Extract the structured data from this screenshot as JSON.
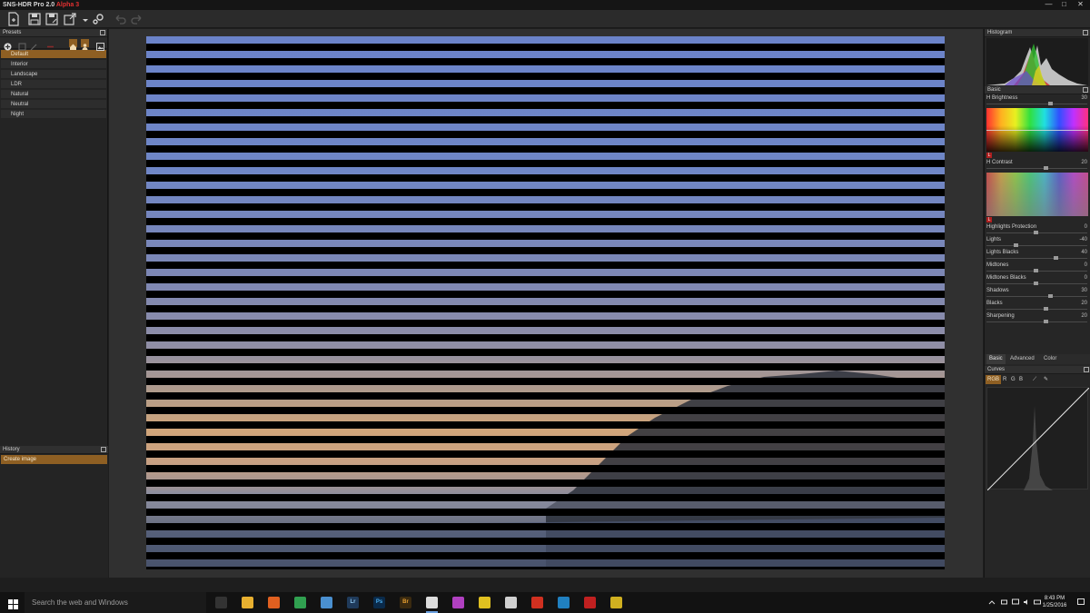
{
  "window": {
    "app_name": "SNS-HDR Pro 2.0",
    "app_version_tag": "Alpha 3",
    "controls": {
      "minimize": "—",
      "maximize": "□",
      "close": "✕"
    }
  },
  "toolbar": {
    "icons": [
      "new-file-icon",
      "save-icon",
      "save-as-icon",
      "export-icon",
      "settings-icon",
      "undo-icon",
      "redo-icon"
    ]
  },
  "presets": {
    "title": "Presets",
    "items": [
      "Default",
      "Interior",
      "Landscape",
      "LDR",
      "Natural",
      "Neutral",
      "Night"
    ],
    "selected": "Default"
  },
  "history": {
    "title": "History",
    "entries": [
      "Create image"
    ]
  },
  "histogram": {
    "title": "Histogram"
  },
  "basic": {
    "title": "Basic",
    "brightness": {
      "label": "Brightness",
      "value": "30",
      "level": 0.65
    },
    "contrast": {
      "label": "Contrast",
      "value": "20",
      "level": 0.6
    },
    "sliders": [
      {
        "label": "Highlights Protection",
        "value": "0",
        "level": 0.5
      },
      {
        "label": "Lights",
        "value": "-40",
        "level": 0.3
      },
      {
        "label": "Lights Blacks",
        "value": "40",
        "level": 0.7
      },
      {
        "label": "Midtones",
        "value": "0",
        "level": 0.5
      },
      {
        "label": "Midtones Blacks",
        "value": "0",
        "level": 0.5
      },
      {
        "label": "Shadows",
        "value": "30",
        "level": 0.65
      },
      {
        "label": "Blacks",
        "value": "20",
        "level": 0.6
      },
      {
        "label": "Sharpening",
        "value": "20",
        "level": 0.6
      }
    ],
    "lock_marker": "L"
  },
  "panel_tabs": [
    "Basic",
    "Advanced",
    "Color"
  ],
  "panel_tab_active": "Basic",
  "curves": {
    "title": "Curves",
    "channels": [
      "RGB",
      "R",
      "G",
      "B"
    ],
    "active_channel": "RGB"
  },
  "taskbar": {
    "search_placeholder": "Search the web and Windows",
    "apps": [
      {
        "name": "task-view-icon",
        "label": ""
      },
      {
        "name": "file-explorer-icon",
        "label": ""
      },
      {
        "name": "firefox-icon",
        "label": ""
      },
      {
        "name": "chrome-icon",
        "label": ""
      },
      {
        "name": "browser-icon",
        "label": ""
      },
      {
        "name": "lightroom-icon",
        "label": "Lr"
      },
      {
        "name": "photoshop-icon",
        "label": "Ps"
      },
      {
        "name": "bridge-icon",
        "label": "Br"
      },
      {
        "name": "sns-hdr-icon",
        "label": ""
      },
      {
        "name": "app-icon-10",
        "label": ""
      },
      {
        "name": "app-icon-11",
        "label": ""
      },
      {
        "name": "app-icon-12",
        "label": ""
      },
      {
        "name": "app-icon-13",
        "label": ""
      },
      {
        "name": "app-icon-14",
        "label": ""
      },
      {
        "name": "app-icon-15",
        "label": ""
      },
      {
        "name": "app-icon-16",
        "label": ""
      }
    ],
    "time": "8:43 PM",
    "date": "1/25/2016"
  },
  "colors": {
    "accent": "#8e5f23",
    "lock_red": "#b02020"
  }
}
